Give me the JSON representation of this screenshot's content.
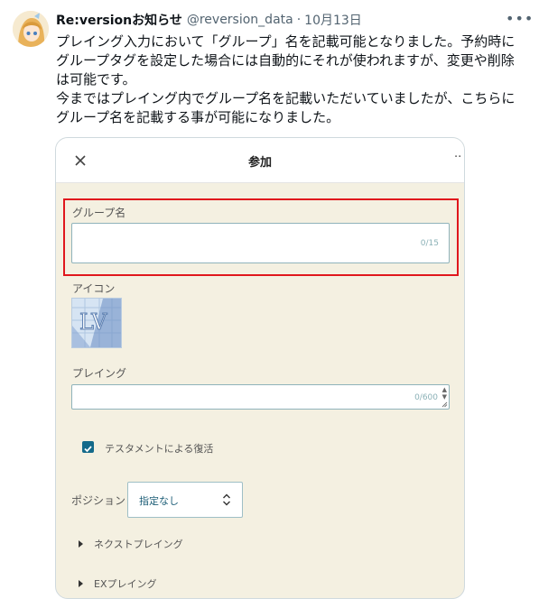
{
  "tweet": {
    "display_name": "Re:versionお知らせ",
    "handle": "@reversion_data",
    "separator": "·",
    "date": "10月13日",
    "lines": [
      "プレイング入力において「グループ」名を記載可能となりました。予約時に",
      "グループタグを設定した場合には自動的にそれが使われますが、変更や削除",
      "は可能です。",
      "今まではプレイング内でグループ名を記載いただいていましたが、こちらに",
      "グループ名を記載する事が可能になりました。"
    ]
  },
  "form": {
    "title": "参加",
    "group_label": "グループ名",
    "group_counter": "0/15",
    "icon_label": "アイコン",
    "icon_monogram": "LV",
    "playing_label": "プレイング",
    "playing_counter": "0/600",
    "testament_label": "テスタメントによる復活",
    "testament_checked": true,
    "position_label": "ポジション",
    "position_value": "指定なし",
    "next_playing": "ネクストプレイング",
    "ex_playing": "EXプレイング"
  },
  "colors": {
    "highlight": "#e0171d",
    "card_background": "#f4f0e1",
    "checkbox": "#146a8a"
  },
  "icons": [
    "avatar",
    "more-icon",
    "close-icon",
    "card-more-icon",
    "chevron-updown-icon",
    "triangle-right-icon",
    "check-icon"
  ]
}
